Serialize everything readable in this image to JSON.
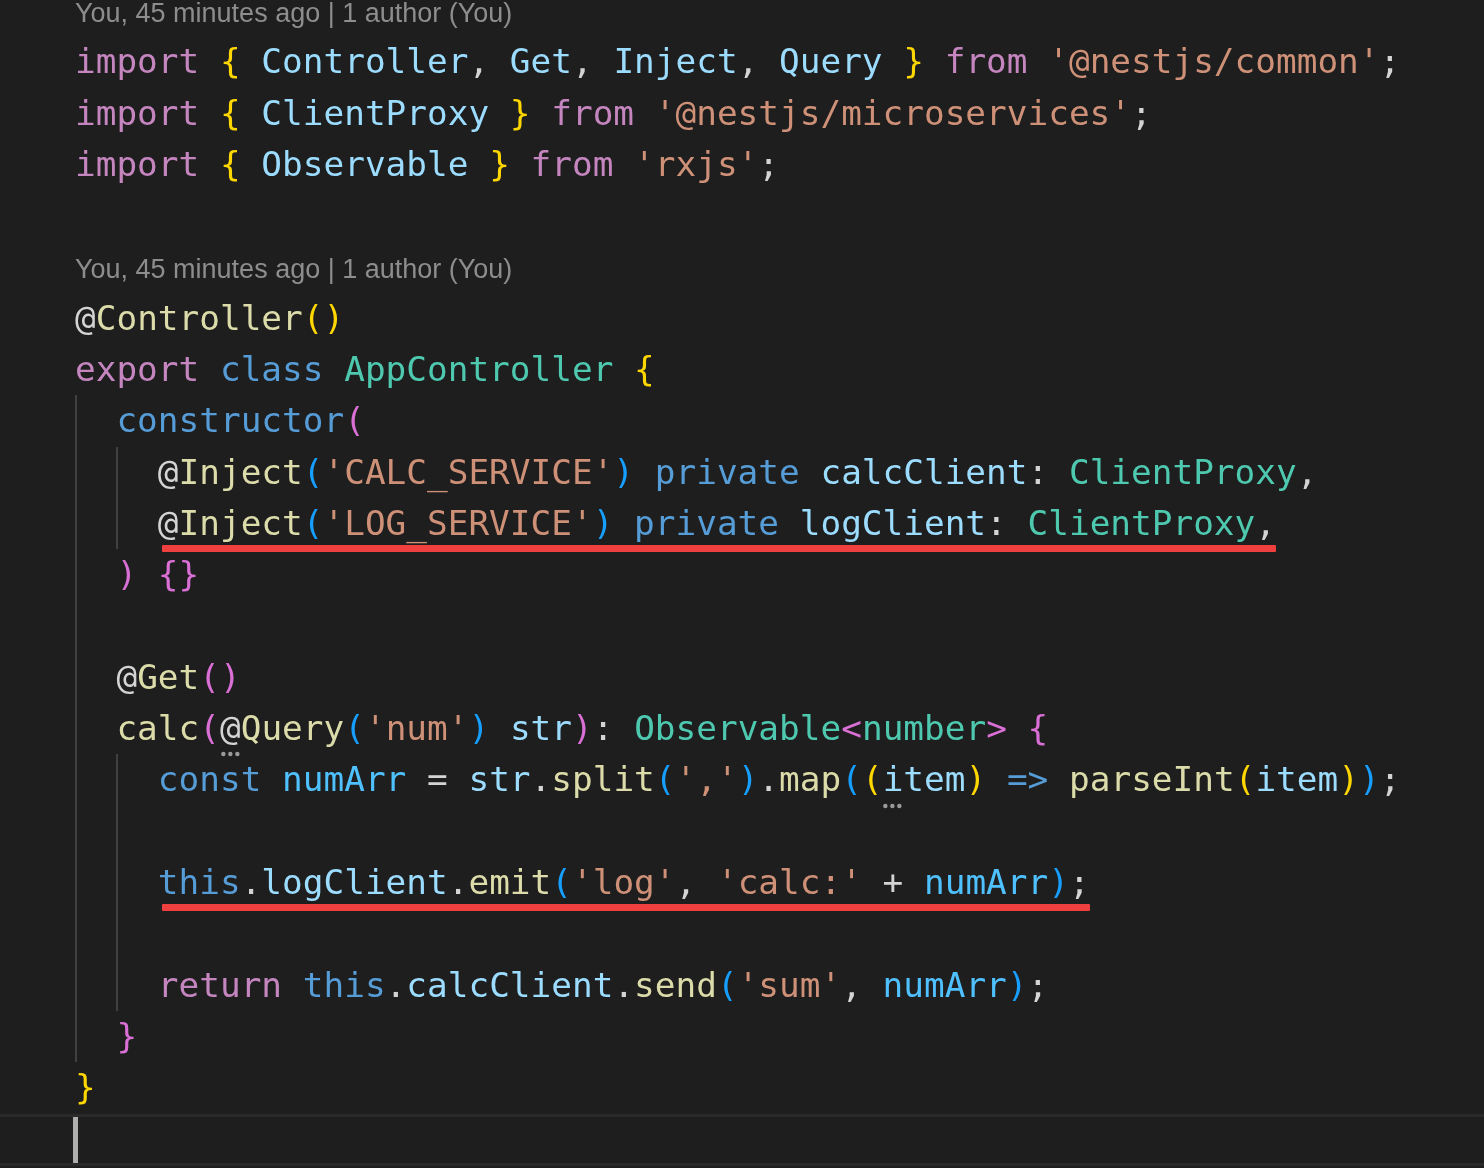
{
  "editor": {
    "lines": [
      {
        "kind": "blame",
        "text": "You, 45 minutes ago | 1 author (You)"
      },
      {
        "kind": "code",
        "tokens": [
          {
            "text": "import ",
            "kind": "kw"
          },
          {
            "text": "{",
            "kind": "brace1"
          },
          {
            "text": " Controller",
            "kind": "var"
          },
          {
            "text": ", ",
            "kind": "punct"
          },
          {
            "text": "Get",
            "kind": "var"
          },
          {
            "text": ", ",
            "kind": "punct"
          },
          {
            "text": "Inject",
            "kind": "var"
          },
          {
            "text": ", ",
            "kind": "punct"
          },
          {
            "text": "Query ",
            "kind": "var"
          },
          {
            "text": "}",
            "kind": "brace1"
          },
          {
            "text": " from ",
            "kind": "kw"
          },
          {
            "text": "'@nestjs/common'",
            "kind": "str"
          },
          {
            "text": ";",
            "kind": "punct"
          }
        ]
      },
      {
        "kind": "code",
        "tokens": [
          {
            "text": "import ",
            "kind": "kw"
          },
          {
            "text": "{",
            "kind": "brace1"
          },
          {
            "text": " ClientProxy ",
            "kind": "var"
          },
          {
            "text": "}",
            "kind": "brace1"
          },
          {
            "text": " from ",
            "kind": "kw"
          },
          {
            "text": "'@nestjs/microservices'",
            "kind": "str"
          },
          {
            "text": ";",
            "kind": "punct"
          }
        ]
      },
      {
        "kind": "code",
        "tokens": [
          {
            "text": "import ",
            "kind": "kw"
          },
          {
            "text": "{",
            "kind": "brace1"
          },
          {
            "text": " Observable ",
            "kind": "var"
          },
          {
            "text": "}",
            "kind": "brace1"
          },
          {
            "text": " from ",
            "kind": "kw"
          },
          {
            "text": "'rxjs'",
            "kind": "str"
          },
          {
            "text": ";",
            "kind": "punct"
          }
        ]
      },
      {
        "kind": "blank"
      },
      {
        "kind": "blame",
        "text": "You, 45 minutes ago | 1 author (You)"
      },
      {
        "kind": "code",
        "tokens": [
          {
            "text": "@",
            "kind": "punct"
          },
          {
            "text": "Controller",
            "kind": "fn"
          },
          {
            "text": "()",
            "kind": "brace1"
          }
        ]
      },
      {
        "kind": "code",
        "tokens": [
          {
            "text": "export",
            "kind": "kw"
          },
          {
            "text": " class ",
            "kind": "storage"
          },
          {
            "text": "AppController ",
            "kind": "type"
          },
          {
            "text": "{",
            "kind": "brace1"
          }
        ]
      },
      {
        "kind": "code",
        "tokens": [
          {
            "text": "  constructor",
            "kind": "storage"
          },
          {
            "text": "(",
            "kind": "brace2"
          }
        ]
      },
      {
        "kind": "code",
        "tokens": [
          {
            "text": "    @",
            "kind": "punct"
          },
          {
            "text": "Inject",
            "kind": "fn"
          },
          {
            "text": "(",
            "kind": "brace3"
          },
          {
            "text": "'CALC_SERVICE'",
            "kind": "str"
          },
          {
            "text": ")",
            "kind": "brace3"
          },
          {
            "text": " private ",
            "kind": "storage"
          },
          {
            "text": "calcClient",
            "kind": "var"
          },
          {
            "text": ": ",
            "kind": "punct"
          },
          {
            "text": "ClientProxy",
            "kind": "type"
          },
          {
            "text": ",",
            "kind": "punct"
          }
        ]
      },
      {
        "kind": "code",
        "underlined": true,
        "tokens": [
          {
            "text": "    @",
            "kind": "punct"
          },
          {
            "text": "Inject",
            "kind": "fn"
          },
          {
            "text": "(",
            "kind": "brace3"
          },
          {
            "text": "'LOG_SERVICE'",
            "kind": "str"
          },
          {
            "text": ")",
            "kind": "brace3"
          },
          {
            "text": " private ",
            "kind": "storage"
          },
          {
            "text": "logClient",
            "kind": "var"
          },
          {
            "text": ": ",
            "kind": "punct"
          },
          {
            "text": "ClientProxy",
            "kind": "type"
          },
          {
            "text": ",",
            "kind": "punct"
          }
        ]
      },
      {
        "kind": "code",
        "tokens": [
          {
            "text": "  ) {}",
            "kind": "brace2"
          }
        ]
      },
      {
        "kind": "blank"
      },
      {
        "kind": "code",
        "tokens": [
          {
            "text": "  @",
            "kind": "punct"
          },
          {
            "text": "Get",
            "kind": "fn"
          },
          {
            "text": "()",
            "kind": "brace2"
          }
        ]
      },
      {
        "kind": "code",
        "tokens": [
          {
            "text": "  calc",
            "kind": "fn"
          },
          {
            "text": "(",
            "kind": "brace2"
          },
          {
            "text": "@",
            "kind": "punct",
            "hinted": true
          },
          {
            "text": "Query",
            "kind": "fn"
          },
          {
            "text": "(",
            "kind": "brace3"
          },
          {
            "text": "'num'",
            "kind": "str"
          },
          {
            "text": ")",
            "kind": "brace3"
          },
          {
            "text": " str",
            "kind": "var"
          },
          {
            "text": ")",
            "kind": "brace2"
          },
          {
            "text": ": ",
            "kind": "punct"
          },
          {
            "text": "Observable",
            "kind": "type"
          },
          {
            "text": "<",
            "kind": "brace2"
          },
          {
            "text": "number",
            "kind": "type"
          },
          {
            "text": "> {",
            "kind": "brace2"
          }
        ]
      },
      {
        "kind": "code",
        "tokens": [
          {
            "text": "    const ",
            "kind": "storage"
          },
          {
            "text": "numArr",
            "kind": "const"
          },
          {
            "text": " = ",
            "kind": "punct"
          },
          {
            "text": "str",
            "kind": "var"
          },
          {
            "text": ".",
            "kind": "punct"
          },
          {
            "text": "split",
            "kind": "fn"
          },
          {
            "text": "(",
            "kind": "brace3"
          },
          {
            "text": "','",
            "kind": "str"
          },
          {
            "text": ")",
            "kind": "brace3"
          },
          {
            "text": ".",
            "kind": "punct"
          },
          {
            "text": "map",
            "kind": "fn"
          },
          {
            "text": "(",
            "kind": "brace3"
          },
          {
            "text": "(",
            "kind": "brace1"
          },
          {
            "text": "item",
            "kind": "var",
            "hinted": true
          },
          {
            "text": ")",
            "kind": "brace1"
          },
          {
            "text": " => ",
            "kind": "storage"
          },
          {
            "text": "parseInt",
            "kind": "fn"
          },
          {
            "text": "(",
            "kind": "brace1"
          },
          {
            "text": "item",
            "kind": "var"
          },
          {
            "text": ")",
            "kind": "brace1"
          },
          {
            "text": ")",
            "kind": "brace3"
          },
          {
            "text": ";",
            "kind": "punct"
          }
        ]
      },
      {
        "kind": "blank"
      },
      {
        "kind": "code",
        "underlined": true,
        "tokens": [
          {
            "text": "    this",
            "kind": "storage"
          },
          {
            "text": ".",
            "kind": "punct"
          },
          {
            "text": "logClient",
            "kind": "var"
          },
          {
            "text": ".",
            "kind": "punct"
          },
          {
            "text": "emit",
            "kind": "fn"
          },
          {
            "text": "(",
            "kind": "brace3"
          },
          {
            "text": "'log'",
            "kind": "str"
          },
          {
            "text": ", ",
            "kind": "punct"
          },
          {
            "text": "'calc:'",
            "kind": "str"
          },
          {
            "text": " + ",
            "kind": "punct"
          },
          {
            "text": "numArr",
            "kind": "const"
          },
          {
            "text": ")",
            "kind": "brace3"
          },
          {
            "text": ";",
            "kind": "punct"
          }
        ]
      },
      {
        "kind": "blank"
      },
      {
        "kind": "code",
        "tokens": [
          {
            "text": "    return ",
            "kind": "kw"
          },
          {
            "text": "this",
            "kind": "storage"
          },
          {
            "text": ".",
            "kind": "punct"
          },
          {
            "text": "calcClient",
            "kind": "var"
          },
          {
            "text": ".",
            "kind": "punct"
          },
          {
            "text": "send",
            "kind": "fn"
          },
          {
            "text": "(",
            "kind": "brace3"
          },
          {
            "text": "'sum'",
            "kind": "str"
          },
          {
            "text": ", ",
            "kind": "punct"
          },
          {
            "text": "numArr",
            "kind": "const"
          },
          {
            "text": ")",
            "kind": "brace3"
          },
          {
            "text": ";",
            "kind": "punct"
          }
        ]
      },
      {
        "kind": "code",
        "tokens": [
          {
            "text": "  }",
            "kind": "brace2"
          }
        ]
      },
      {
        "kind": "code",
        "tokens": [
          {
            "text": "}",
            "kind": "brace1"
          }
        ]
      },
      {
        "kind": "current"
      }
    ]
  }
}
